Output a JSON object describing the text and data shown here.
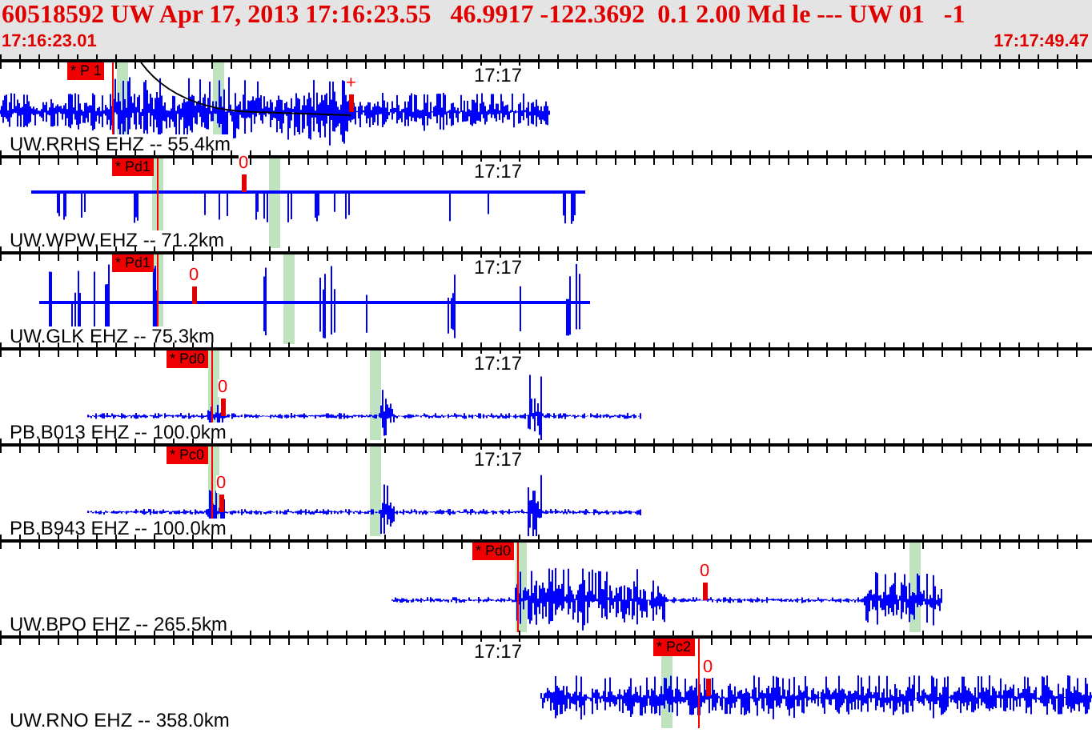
{
  "header": {
    "event_line": "60518592 UW Apr 17, 2013 17:16:23.55   46.9917 -122.3692  0.1 2.00 Md le --- UW 01   -1",
    "start_time": "17:16:23.01",
    "end_time": "17:17:49.47"
  },
  "traces": [
    {
      "station": "UW.RRHS EHZ -- 55.4km",
      "pick": "* P 1",
      "marker": "+",
      "time_label": "17:17"
    },
    {
      "station": "UW.WPW.EHZ -- 71.2km",
      "pick": "* Pd1",
      "marker": "0",
      "time_label": "17:17"
    },
    {
      "station": "UW.GLK EHZ -- 75.3km",
      "pick": "* Pd1",
      "marker": "0",
      "time_label": "17:17"
    },
    {
      "station": "PB.B013 EHZ -- 100.0km",
      "pick": "* Pd0",
      "marker": "0",
      "time_label": "17:17"
    },
    {
      "station": "PB.B943 EHZ -- 100.0km",
      "pick": "* Pc0",
      "marker": "0",
      "time_label": "17:17"
    },
    {
      "station": "UW.BPO EHZ -- 265.5km",
      "pick": "* Pd0",
      "marker": "0"
    },
    {
      "station": "UW.RNO EHZ -- 358.0km",
      "pick": "* Pc2",
      "marker": "0",
      "time_label": "17:17"
    }
  ]
}
